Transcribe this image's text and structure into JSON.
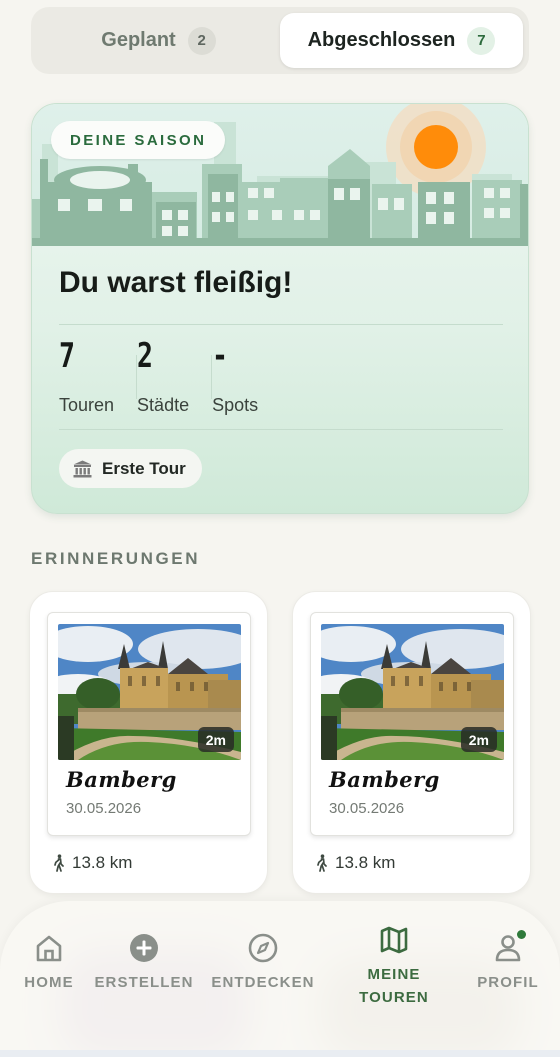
{
  "tabs": [
    {
      "label": "Geplant",
      "count": "2",
      "active": false
    },
    {
      "label": "Abgeschlossen",
      "count": "7",
      "active": true
    }
  ],
  "season": {
    "pill": "DEINE SAISON",
    "title": "Du warst fleißig!",
    "stats": [
      {
        "value": "7",
        "label": "Touren"
      },
      {
        "value": "2",
        "label": "Städte"
      },
      {
        "value": "-",
        "label": "Spots"
      }
    ],
    "badge": {
      "icon": "museum-icon",
      "label": "Erste Tour"
    },
    "colors": {
      "sun": "#ff8c0a",
      "buildings": "#8fb7a0"
    }
  },
  "memories": {
    "section_label": "ERINNERUNGEN",
    "items": [
      {
        "city": "Bamberg",
        "date": "30.05.2026",
        "duration": "2m",
        "distance": "13.8 km"
      },
      {
        "city": "Bamberg",
        "date": "30.05.2026",
        "duration": "2m",
        "distance": "13.8 km"
      }
    ]
  },
  "nav": {
    "items": [
      {
        "label": "HOME",
        "icon": "home-icon",
        "active": false
      },
      {
        "label": "ERSTELLEN",
        "icon": "plus-circle-icon",
        "active": false
      },
      {
        "label": "ENTDECKEN",
        "icon": "compass-icon",
        "active": false
      },
      {
        "label": "MEINE TOUREN",
        "icon": "map-icon",
        "active": true
      },
      {
        "label": "PROFIL",
        "icon": "user-icon",
        "active": false,
        "notification_dot": true
      }
    ],
    "active_color": "#3c6b40"
  }
}
